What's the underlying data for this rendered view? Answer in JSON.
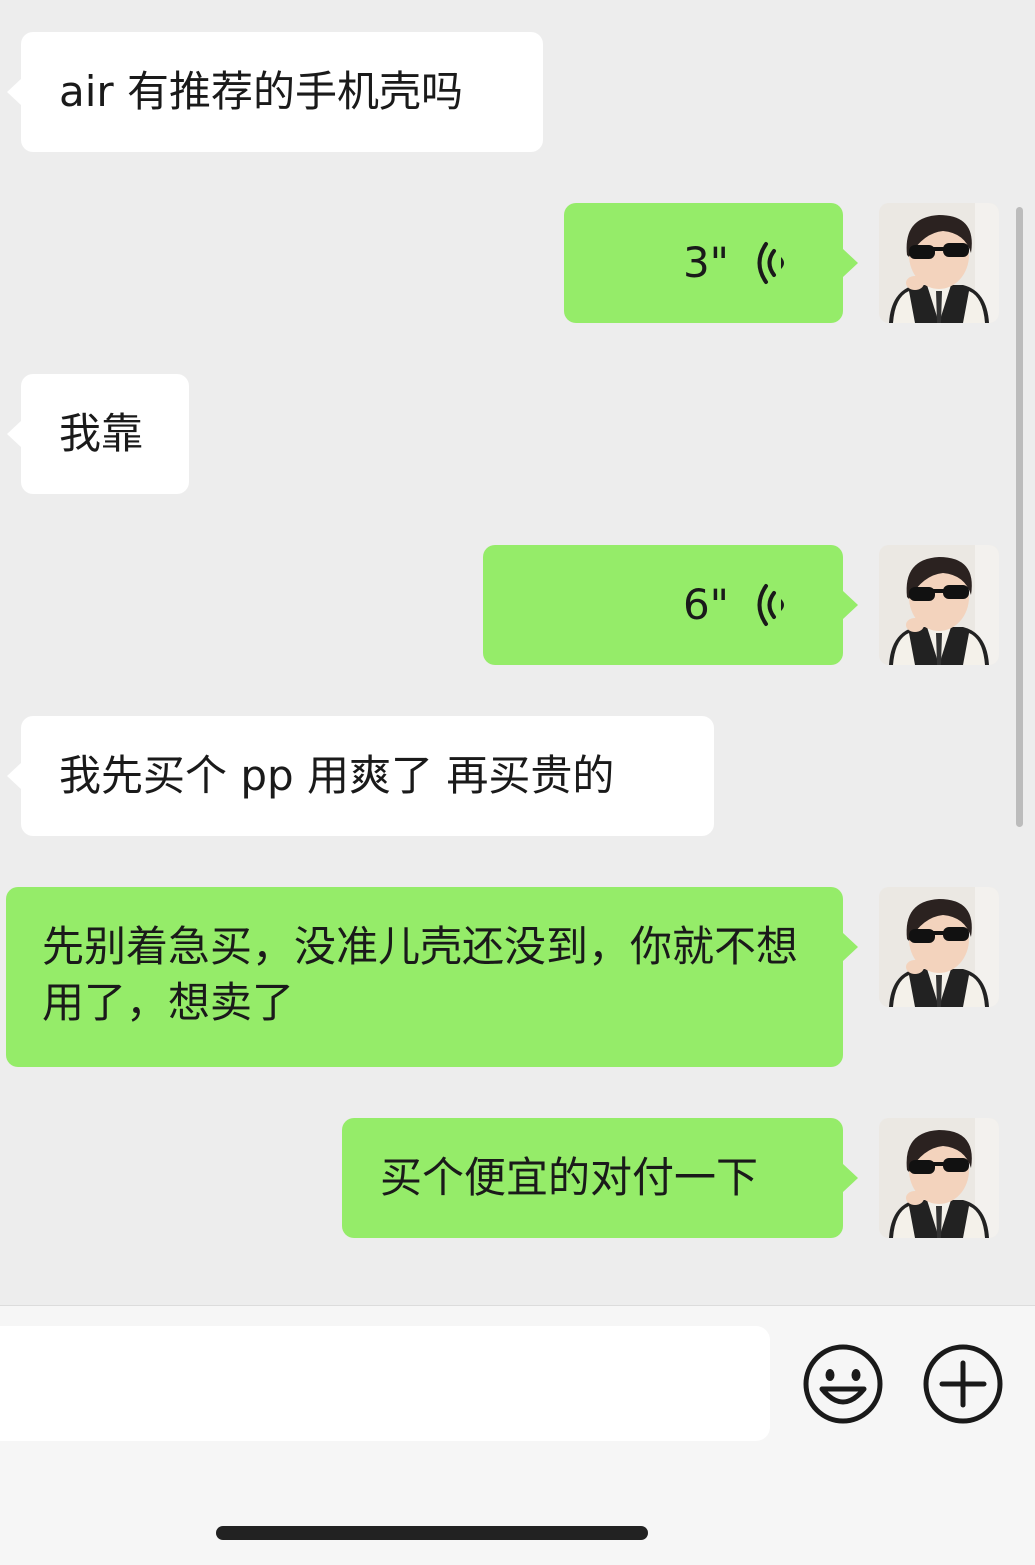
{
  "messages": [
    {
      "side": "incoming",
      "type": "text",
      "text": "air 有推荐的手机壳吗"
    },
    {
      "side": "outgoing",
      "type": "voice",
      "duration": "3\""
    },
    {
      "side": "incoming",
      "type": "text",
      "text": "我靠"
    },
    {
      "side": "outgoing",
      "type": "voice",
      "duration": "6\""
    },
    {
      "side": "incoming",
      "type": "text",
      "text": "我先买个 pp 用爽了 再买贵的"
    },
    {
      "side": "outgoing",
      "type": "text",
      "text": "先别着急买，没准儿壳还没到，你就不想用了，想卖了"
    },
    {
      "side": "outgoing",
      "type": "text",
      "text": "买个便宜的对付一下"
    }
  ],
  "input_bar": {
    "input_value": "",
    "icons": [
      "emoji-icon",
      "plus-icon"
    ]
  },
  "colors": {
    "background": "#ededed",
    "incoming_bubble": "#ffffff",
    "outgoing_bubble": "#95ec69"
  }
}
